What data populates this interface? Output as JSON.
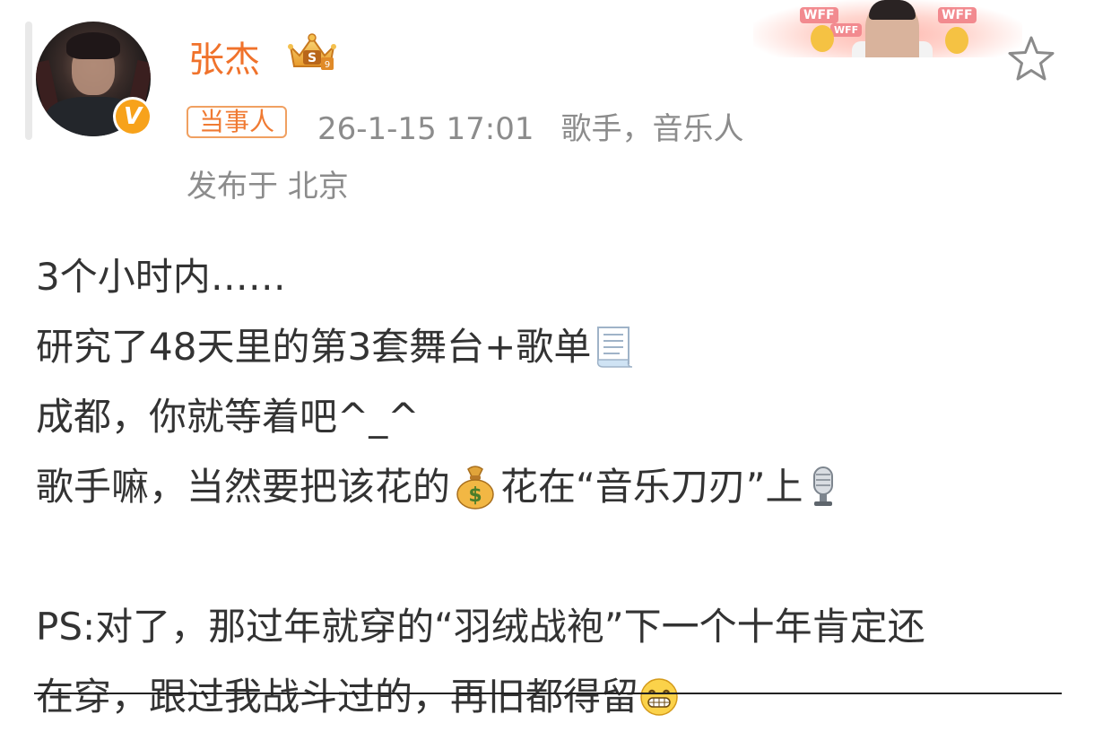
{
  "post": {
    "author": {
      "name": "张杰",
      "verified_badge": "v-badge",
      "crown_badge": "crown-icon"
    },
    "tag": "当事人",
    "timestamp": "26-1-15 17:01",
    "role": "歌手，音乐人",
    "location": "发布于 北京",
    "content_lines": [
      {
        "text": "3个小时内……"
      },
      {
        "text": "研究了48天里的第3套舞台+歌单",
        "emoji": "memo-icon"
      },
      {
        "text": "成都，你就等着吧^_^"
      },
      {
        "text_before": "歌手嘛，当然要把该花的",
        "emoji_mid": "money-bag-icon",
        "text_after": "花在“音乐刀刃”上",
        "emoji_end": "microphone-icon"
      },
      {
        "text": ""
      },
      {
        "text": "PS:对了，那过年就穿的“羽绒战袍”下一个十年肯定还"
      },
      {
        "text": "在穿，跟过我战斗过的，再旧都得留",
        "emoji": "grin-icon"
      }
    ]
  },
  "banner": {
    "labels": [
      "WFF",
      "WFF",
      "WFF"
    ]
  },
  "colors": {
    "username": "#f0722b",
    "tag_border": "#f0a061",
    "meta": "#8c8c8c",
    "text": "#333333"
  },
  "icons": {
    "favorite": "star-outline-icon"
  }
}
